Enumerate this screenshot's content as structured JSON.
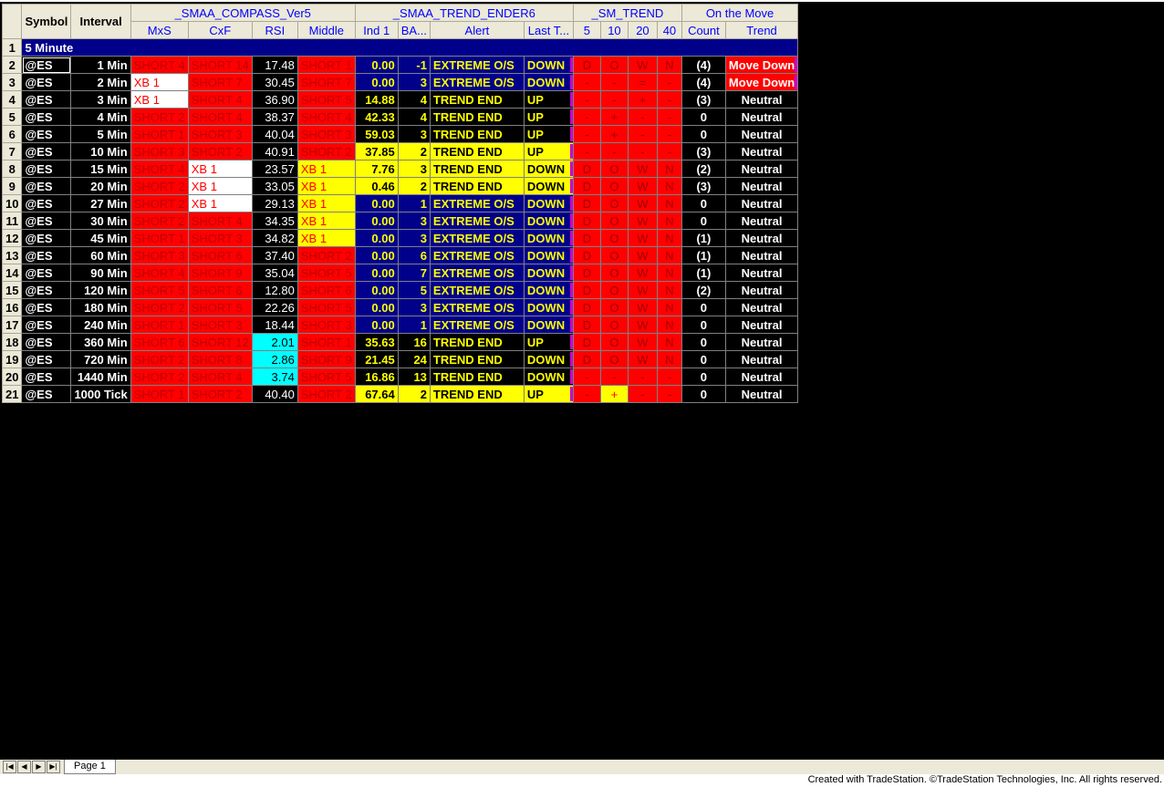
{
  "headers": {
    "row1": [
      {
        "text": "Symbol",
        "span": 1,
        "rows": 2,
        "bold": true
      },
      {
        "text": "Interval",
        "span": 1,
        "rows": 2,
        "bold": true
      },
      {
        "text": "_SMAA_COMPASS_Ver5",
        "span": 4
      },
      {
        "text": "_SMAA_TREND_ENDER6",
        "span": 4
      },
      {
        "text": "_SM_TREND",
        "span": 4
      },
      {
        "text": "On the Move",
        "span": 2
      }
    ],
    "row2": [
      "MxS",
      "CxF",
      "RSI",
      "Middle",
      "Ind 1",
      "BA...",
      "Alert",
      "Last T...",
      "5",
      "10",
      "20",
      "40",
      "Count",
      "Trend"
    ]
  },
  "section_label": "5 Minute",
  "rows": [
    {
      "n": "2",
      "sym": "@ES",
      "intv": "1 Min",
      "mxs": [
        "SHORT 4",
        "red"
      ],
      "cxf": [
        "SHORT 14",
        "red"
      ],
      "rsi": [
        "17.48",
        ""
      ],
      "mid": [
        "SHORT 1",
        "red"
      ],
      "ind": [
        "0.00",
        "b"
      ],
      "ba": "-1",
      "alert": "EXTREME O/S",
      "last": "DOWN",
      "sm": [
        "D",
        "O",
        "W",
        "N"
      ],
      "smy": [],
      "cnt": "(4)",
      "trend": "Move Down"
    },
    {
      "n": "3",
      "sym": "@ES",
      "intv": "2 Min",
      "mxs": [
        "XB 1",
        "white"
      ],
      "cxf": [
        "SHORT 7",
        "red"
      ],
      "rsi": [
        "30.45",
        ""
      ],
      "mid": [
        "SHORT 7",
        "red"
      ],
      "ind": [
        "0.00",
        "b"
      ],
      "ba": "3",
      "alert": "EXTREME O/S",
      "last": "DOWN",
      "sm": [
        "-",
        "-",
        "=",
        "-"
      ],
      "smy": [],
      "cnt": "(4)",
      "trend": "Move Down"
    },
    {
      "n": "4",
      "sym": "@ES",
      "intv": "3 Min",
      "mxs": [
        "XB 1",
        "white"
      ],
      "cxf": [
        "SHORT 4",
        "red"
      ],
      "rsi": [
        "36.90",
        ""
      ],
      "mid": [
        "SHORT 5",
        "red"
      ],
      "ind": [
        "14.88",
        "k"
      ],
      "ba": "4",
      "alert": "TREND END",
      "last": "UP",
      "sm": [
        "-",
        "-",
        "+",
        "-"
      ],
      "smy": [],
      "cnt": "(3)",
      "trend": "Neutral"
    },
    {
      "n": "5",
      "sym": "@ES",
      "intv": "4 Min",
      "mxs": [
        "SHORT 2",
        "red"
      ],
      "cxf": [
        "SHORT 4",
        "red"
      ],
      "rsi": [
        "38.37",
        ""
      ],
      "mid": [
        "SHORT 4",
        "red"
      ],
      "ind": [
        "42.33",
        "k"
      ],
      "ba": "4",
      "alert": "TREND END",
      "last": "UP",
      "sm": [
        "-",
        "+",
        "-",
        "-"
      ],
      "smy": [],
      "cnt": "0",
      "trend": "Neutral"
    },
    {
      "n": "6",
      "sym": "@ES",
      "intv": "5 Min",
      "mxs": [
        "SHORT 1",
        "red"
      ],
      "cxf": [
        "SHORT 3",
        "red"
      ],
      "rsi": [
        "40.04",
        ""
      ],
      "mid": [
        "SHORT 3",
        "red"
      ],
      "ind": [
        "59.03",
        "k"
      ],
      "ba": "3",
      "alert": "TREND END",
      "last": "UP",
      "sm": [
        "-",
        "+",
        "-",
        "-"
      ],
      "smy": [],
      "cnt": "0",
      "trend": "Neutral"
    },
    {
      "n": "7",
      "sym": "@ES",
      "intv": "10 Min",
      "mxs": [
        "SHORT 3",
        "red"
      ],
      "cxf": [
        "SHORT 2",
        "red"
      ],
      "rsi": [
        "40.91",
        ""
      ],
      "mid": [
        "SHORT 2",
        "red"
      ],
      "ind": [
        "37.85",
        "y"
      ],
      "ba": "2",
      "alert": "TREND END",
      "last": "UP",
      "sm": [
        "-",
        "-",
        "-",
        "-"
      ],
      "smy": [],
      "cnt": "(3)",
      "trend": "Neutral"
    },
    {
      "n": "8",
      "sym": "@ES",
      "intv": "15 Min",
      "mxs": [
        "SHORT 4",
        "red"
      ],
      "cxf": [
        "XB 1",
        "white"
      ],
      "rsi": [
        "23.57",
        ""
      ],
      "mid": [
        "XB 1",
        "yel"
      ],
      "ind": [
        "7.76",
        "y"
      ],
      "ba": "3",
      "alert": "TREND END",
      "last": "DOWN",
      "sm": [
        "D",
        "O",
        "W",
        "N"
      ],
      "smy": [],
      "cnt": "(2)",
      "trend": "Neutral"
    },
    {
      "n": "9",
      "sym": "@ES",
      "intv": "20 Min",
      "mxs": [
        "SHORT 2",
        "red"
      ],
      "cxf": [
        "XB 1",
        "white"
      ],
      "rsi": [
        "33.05",
        ""
      ],
      "mid": [
        "XB 1",
        "yel"
      ],
      "ind": [
        "0.46",
        "y"
      ],
      "ba": "2",
      "alert": "TREND END",
      "last": "DOWN",
      "sm": [
        "D",
        "O",
        "W",
        "N"
      ],
      "smy": [],
      "cnt": "(3)",
      "trend": "Neutral"
    },
    {
      "n": "10",
      "sym": "@ES",
      "intv": "27 Min",
      "mxs": [
        "SHORT 2",
        "red"
      ],
      "cxf": [
        "XB 1",
        "white"
      ],
      "rsi": [
        "29.13",
        ""
      ],
      "mid": [
        "XB 1",
        "yel"
      ],
      "ind": [
        "0.00",
        "b"
      ],
      "ba": "1",
      "alert": "EXTREME O/S",
      "last": "DOWN",
      "sm": [
        "D",
        "O",
        "W",
        "N"
      ],
      "smy": [],
      "cnt": "0",
      "trend": "Neutral"
    },
    {
      "n": "11",
      "sym": "@ES",
      "intv": "30 Min",
      "mxs": [
        "SHORT 2",
        "red"
      ],
      "cxf": [
        "SHORT 4",
        "red"
      ],
      "rsi": [
        "34.35",
        ""
      ],
      "mid": [
        "XB 1",
        "yel"
      ],
      "ind": [
        "0.00",
        "b"
      ],
      "ba": "3",
      "alert": "EXTREME O/S",
      "last": "DOWN",
      "sm": [
        "D",
        "O",
        "W",
        "N"
      ],
      "smy": [],
      "cnt": "0",
      "trend": "Neutral"
    },
    {
      "n": "12",
      "sym": "@ES",
      "intv": "45 Min",
      "mxs": [
        "SHORT 1",
        "red"
      ],
      "cxf": [
        "SHORT 3",
        "red"
      ],
      "rsi": [
        "34.82",
        ""
      ],
      "mid": [
        "XB 1",
        "yel"
      ],
      "ind": [
        "0.00",
        "b"
      ],
      "ba": "3",
      "alert": "EXTREME O/S",
      "last": "DOWN",
      "sm": [
        "D",
        "O",
        "W",
        "N"
      ],
      "smy": [],
      "cnt": "(1)",
      "trend": "Neutral"
    },
    {
      "n": "13",
      "sym": "@ES",
      "intv": "60 Min",
      "mxs": [
        "SHORT 3",
        "red"
      ],
      "cxf": [
        "SHORT 6",
        "red"
      ],
      "rsi": [
        "37.40",
        ""
      ],
      "mid": [
        "SHORT 2",
        "red"
      ],
      "ind": [
        "0.00",
        "b"
      ],
      "ba": "6",
      "alert": "EXTREME O/S",
      "last": "DOWN",
      "sm": [
        "D",
        "O",
        "W",
        "N"
      ],
      "smy": [],
      "cnt": "(1)",
      "trend": "Neutral"
    },
    {
      "n": "14",
      "sym": "@ES",
      "intv": "90 Min",
      "mxs": [
        "SHORT 4",
        "red"
      ],
      "cxf": [
        "SHORT 9",
        "red"
      ],
      "rsi": [
        "35.04",
        ""
      ],
      "mid": [
        "SHORT 5",
        "red"
      ],
      "ind": [
        "0.00",
        "b"
      ],
      "ba": "7",
      "alert": "EXTREME O/S",
      "last": "DOWN",
      "sm": [
        "D",
        "O",
        "W",
        "N"
      ],
      "smy": [],
      "cnt": "(1)",
      "trend": "Neutral"
    },
    {
      "n": "15",
      "sym": "@ES",
      "intv": "120 Min",
      "mxs": [
        "SHORT 5",
        "red"
      ],
      "cxf": [
        "SHORT 6",
        "red"
      ],
      "rsi": [
        "12.80",
        ""
      ],
      "mid": [
        "SHORT 6",
        "red"
      ],
      "ind": [
        "0.00",
        "b"
      ],
      "ba": "5",
      "alert": "EXTREME O/S",
      "last": "DOWN",
      "sm": [
        "D",
        "O",
        "W",
        "N"
      ],
      "smy": [],
      "cnt": "(2)",
      "trend": "Neutral"
    },
    {
      "n": "16",
      "sym": "@ES",
      "intv": "180 Min",
      "mxs": [
        "SHORT 2",
        "red"
      ],
      "cxf": [
        "SHORT 5",
        "red"
      ],
      "rsi": [
        "22.26",
        ""
      ],
      "mid": [
        "SHORT 5",
        "red"
      ],
      "ind": [
        "0.00",
        "b"
      ],
      "ba": "3",
      "alert": "EXTREME O/S",
      "last": "DOWN",
      "sm": [
        "D",
        "O",
        "W",
        "N"
      ],
      "smy": [],
      "cnt": "0",
      "trend": "Neutral"
    },
    {
      "n": "17",
      "sym": "@ES",
      "intv": "240 Min",
      "mxs": [
        "SHORT 1",
        "red"
      ],
      "cxf": [
        "SHORT 3",
        "red"
      ],
      "rsi": [
        "18.44",
        ""
      ],
      "mid": [
        "SHORT 3",
        "red"
      ],
      "ind": [
        "0.00",
        "b"
      ],
      "ba": "1",
      "alert": "EXTREME O/S",
      "last": "DOWN",
      "sm": [
        "D",
        "O",
        "W",
        "N"
      ],
      "smy": [],
      "cnt": "0",
      "trend": "Neutral"
    },
    {
      "n": "18",
      "sym": "@ES",
      "intv": "360 Min",
      "mxs": [
        "SHORT 6",
        "red"
      ],
      "cxf": [
        "SHORT 12",
        "red"
      ],
      "rsi": [
        "2.01",
        "cyan"
      ],
      "mid": [
        "SHORT 1",
        "red"
      ],
      "ind": [
        "35.63",
        "k"
      ],
      "ba": "16",
      "alert": "TREND END",
      "last": "UP",
      "sm": [
        "D",
        "O",
        "W",
        "N"
      ],
      "smy": [],
      "cnt": "0",
      "trend": "Neutral"
    },
    {
      "n": "19",
      "sym": "@ES",
      "intv": "720 Min",
      "mxs": [
        "SHORT 2",
        "red"
      ],
      "cxf": [
        "SHORT 8",
        "red"
      ],
      "rsi": [
        "2.86",
        "cyan"
      ],
      "mid": [
        "SHORT 9",
        "red"
      ],
      "ind": [
        "21.45",
        "k"
      ],
      "ba": "24",
      "alert": "TREND END",
      "last": "DOWN",
      "sm": [
        "D",
        "O",
        "W",
        "N"
      ],
      "smy": [],
      "cnt": "0",
      "trend": "Neutral"
    },
    {
      "n": "20",
      "sym": "@ES",
      "intv": "1440 Min",
      "mxs": [
        "SHORT 2",
        "red"
      ],
      "cxf": [
        "SHORT 4",
        "red"
      ],
      "rsi": [
        "3.74",
        "cyan"
      ],
      "mid": [
        "SHORT 5",
        "red"
      ],
      "ind": [
        "16.86",
        "k"
      ],
      "ba": "13",
      "alert": "TREND END",
      "last": "DOWN",
      "sm": [
        "-",
        "-",
        "-",
        "-"
      ],
      "smy": [],
      "cnt": "0",
      "trend": "Neutral"
    },
    {
      "n": "21",
      "sym": "@ES",
      "intv": "1000 Tick",
      "mxs": [
        "SHORT 1",
        "red"
      ],
      "cxf": [
        "SHORT 2",
        "red"
      ],
      "rsi": [
        "40.40",
        ""
      ],
      "mid": [
        "SHORT 2",
        "red"
      ],
      "ind": [
        "67.64",
        "y"
      ],
      "ba": "2",
      "alert": "TREND END",
      "last": "UP",
      "sm": [
        "-",
        "+",
        "-",
        "-"
      ],
      "smy": [
        1
      ],
      "cnt": "0",
      "trend": "Neutral"
    }
  ],
  "sheet_tab": "Page 1",
  "nav_buttons": [
    "|◀",
    "◀",
    "▶",
    "▶|"
  ],
  "footer": "Created with TradeStation. ©TradeStation Technologies, Inc. All rights reserved.",
  "colors": {
    "red": "#ff0000",
    "navy": "#00008b",
    "yellow": "#ffff00",
    "cyan": "#00ffff",
    "header_bg": "#ece9d8",
    "header_text": "#0000ff"
  }
}
